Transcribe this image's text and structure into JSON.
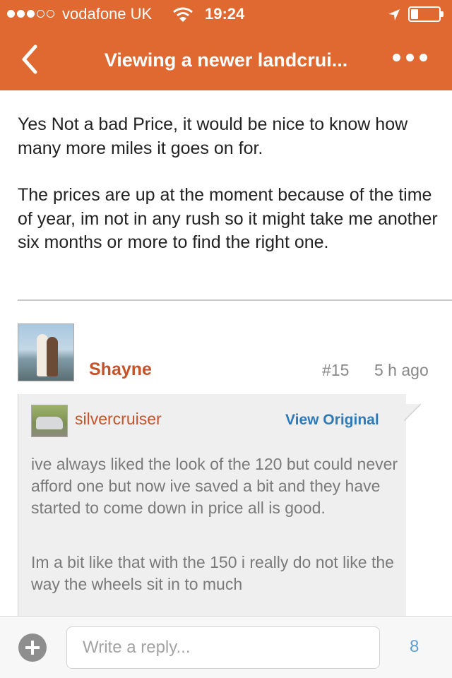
{
  "status_bar": {
    "carrier": "vodafone UK",
    "time": "19:24",
    "signal_bars_filled": 3,
    "signal_bars_total": 5,
    "battery_level": 0.2
  },
  "nav": {
    "title": "Viewing a newer landcrui...",
    "back_icon": "chevron-left-icon",
    "more_icon": "more-horizontal-icon"
  },
  "post": {
    "paragraphs": [
      "Yes Not a bad Price, it would be nice to know how many more miles it goes on for.",
      "The prices are up at the moment because of the time of year, im not in any rush so it might take me another six months or more to find the right one."
    ]
  },
  "reply_post": {
    "username": "Shayne",
    "number": "#15",
    "time": "5 h ago",
    "quote": {
      "username": "silvercruiser",
      "view_original": "View Original",
      "paragraphs": [
        "ive always liked the look of the 120 but could never afford one but now ive saved a bit and they have started to come down in price all is good.",
        "Im a bit like that with the 150 i really do not like the way the wheels sit in to much"
      ]
    }
  },
  "reply_bar": {
    "placeholder": "Write a reply...",
    "count": "8"
  },
  "colors": {
    "accent": "#e06831",
    "username": "#c5532a",
    "link": "#2e79b8",
    "count": "#5b9fd6"
  }
}
